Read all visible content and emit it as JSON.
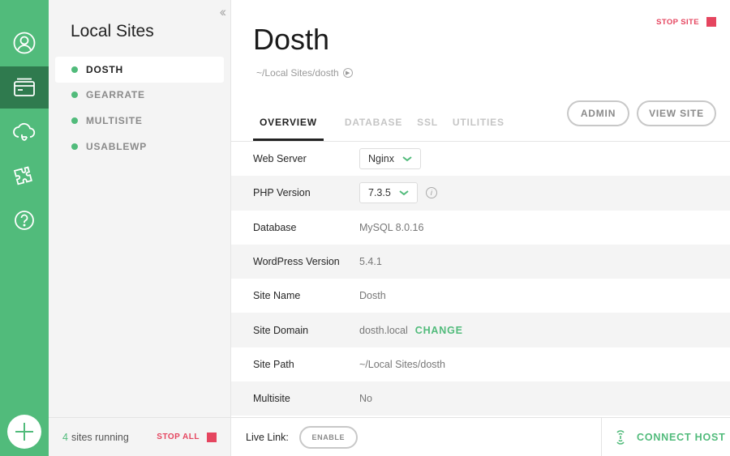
{
  "rail": {
    "icons": [
      "user-icon",
      "sites-icon",
      "cloud-icon",
      "addons-icon",
      "help-icon"
    ],
    "active": "sites-icon",
    "add_icon": "plus-icon"
  },
  "sidebar": {
    "title": "Local Sites",
    "sites": [
      {
        "name": "DOSTH",
        "status": "running"
      },
      {
        "name": "GEARRATE",
        "status": "running"
      },
      {
        "name": "MULTISITE",
        "status": "running"
      },
      {
        "name": "USABLEWP",
        "status": "running"
      }
    ],
    "running_count": "4",
    "running_text": "sites running",
    "stop_all_label": "STOP ALL"
  },
  "site": {
    "title": "Dosth",
    "path": "~/Local Sites/dosth",
    "stop_label": "STOP SITE",
    "admin_label": "ADMIN",
    "view_site_label": "VIEW SITE",
    "tabs": [
      "OVERVIEW",
      "DATABASE",
      "SSL",
      "UTILITIES"
    ],
    "active_tab": "OVERVIEW",
    "rows": {
      "web_server": {
        "label": "Web Server",
        "value": "Nginx"
      },
      "php_version": {
        "label": "PHP Version",
        "value": "7.3.5"
      },
      "database": {
        "label": "Database",
        "value": "MySQL 8.0.16"
      },
      "wp_version": {
        "label": "WordPress Version",
        "value": "5.4.1"
      },
      "site_name": {
        "label": "Site Name",
        "value": "Dosth"
      },
      "site_domain": {
        "label": "Site Domain",
        "value": "dosth.local",
        "action": "CHANGE"
      },
      "site_path": {
        "label": "Site Path",
        "value": "~/Local Sites/dosth"
      },
      "multisite": {
        "label": "Multisite",
        "value": "No"
      }
    },
    "live_link_label": "Live Link:",
    "enable_label": "ENABLE",
    "connect_host_label": "CONNECT HOST"
  },
  "colors": {
    "brand_green": "#51bb7b",
    "rail_active": "#2f7a4e",
    "stop_red": "#e5455f"
  }
}
